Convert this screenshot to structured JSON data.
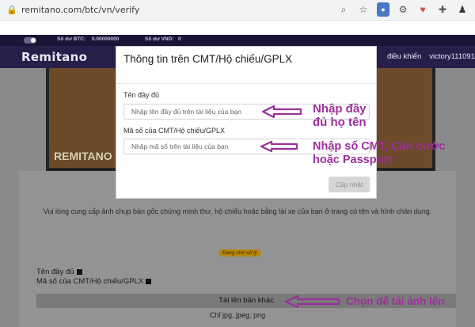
{
  "browser": {
    "url": "remitano.com/btc/vn/verify",
    "icons": [
      "search-icon",
      "star-icon",
      "profile-icon",
      "gear-icon",
      "heart-icon",
      "puzzle-icon",
      "user-icon"
    ]
  },
  "header": {
    "balance_btc_label": "Số dư BTC:",
    "balance_btc_value": "0.00000000",
    "balance_vnd_label": "Số dư VND:",
    "balance_vnd_value": "0",
    "logo": "Remitano",
    "nav_right": [
      "điều khiển",
      "victory111091"
    ]
  },
  "background": {
    "watermark": "REMITANO",
    "instruction": "Vui lòng cung cấp ảnh chụp bản gốc chứng minh thư, hộ chiếu hoặc bằng lái xe của bạn ở trang có tên và hình chân dung.",
    "status_badge": "Đang chờ xử lý",
    "full_name_label": "Tên đầy đủ",
    "id_number_label": "Mã số của CMT/Hộ chiếu/GPLX",
    "upload_button": "Tải lên bản khác",
    "file_types": "Chỉ jpg, jpeg, png"
  },
  "modal": {
    "title": "Thông tin trên CMT/Hộ chiếu/GPLX",
    "name_label": "Tên đầy đủ",
    "name_placeholder": "Nhập tên đầy đủ trên tài liệu của bạn",
    "id_label": "Mã số của CMT/Hộ chiếu/GPLX",
    "id_placeholder": "Nhập mã số trên tài liệu của bạn",
    "submit": "Cập nhật"
  },
  "annotations": {
    "note1_line1": "Nhập đầy",
    "note1_line2": "đủ họ tên",
    "note2_line1": "Nhập số CMT, Căn cước",
    "note2_line2": "hoặc Passport",
    "note3": "Chọn để tải ảnh lên",
    "arrow_color": "#9c2f9c"
  }
}
